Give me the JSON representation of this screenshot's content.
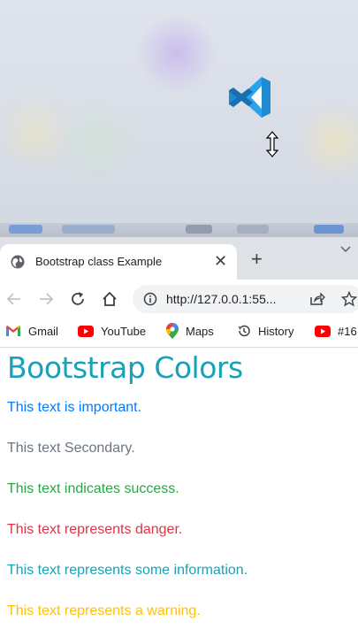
{
  "browser": {
    "tab": {
      "title": "Bootstrap class Example"
    },
    "toolbar": {
      "url": "http://127.0.0.1:55..."
    },
    "bookmarks": [
      {
        "label": "Gmail",
        "icon": "gmail-icon"
      },
      {
        "label": "YouTube",
        "icon": "youtube-icon"
      },
      {
        "label": "Maps",
        "icon": "maps-icon"
      },
      {
        "label": "History",
        "icon": "history-icon"
      },
      {
        "label": "#16",
        "icon": "youtube-icon"
      }
    ]
  },
  "page": {
    "heading": "Bootstrap Colors",
    "lines": [
      {
        "text": "This text is important.",
        "color": "#007bff"
      },
      {
        "text": "This text Secondary.",
        "color": "#6c757d"
      },
      {
        "text": "This text indicates success.",
        "color": "#28a745"
      },
      {
        "text": "This text represents danger.",
        "color": "#dc3545"
      },
      {
        "text": "This text represents some information.",
        "color": "#17a2b8"
      },
      {
        "text": "This text represents a warning.",
        "color": "#ffc107"
      }
    ]
  },
  "colors": {
    "heading": "#17a2b8",
    "vscode_blue": "#1f8ad2"
  }
}
